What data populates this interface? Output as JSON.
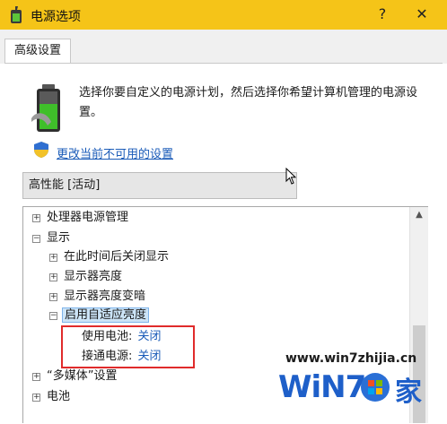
{
  "window": {
    "title": "电源选项",
    "help": "?",
    "close": "✕"
  },
  "tab": {
    "label": "高级设置"
  },
  "description": "选择你要自定义的电源计划，然后选择你希望计算机管理的电源设置。",
  "change_link": "更改当前不可用的设置",
  "plan": {
    "selected": "高性能 [活动]"
  },
  "tree": [
    {
      "label": "处理器电源管理",
      "expander": "+"
    },
    {
      "label": "显示",
      "expander": "−"
    },
    {
      "label": "在此时间后关闭显示",
      "expander": "+"
    },
    {
      "label": "显示器亮度",
      "expander": "+"
    },
    {
      "label": "显示器亮度变暗",
      "expander": "+"
    },
    {
      "label": "启用自适应亮度",
      "expander": "−"
    },
    {
      "label": "使用电池:",
      "value": "关闭"
    },
    {
      "label": "接通电源:",
      "value": "关闭"
    },
    {
      "label": "“多媒体”设置",
      "expander": "+"
    },
    {
      "label": "电池",
      "expander": "+"
    }
  ],
  "scrollbar": {
    "up": "▲"
  },
  "watermark": {
    "url": "www.win7zhijia.cn",
    "brand": "WiN7",
    "suffix": "家"
  },
  "colors": {
    "titlebar": "#f5c418",
    "link": "#1a5bb8",
    "highlight": "#e02b2b",
    "selection": "#cce4f7"
  }
}
